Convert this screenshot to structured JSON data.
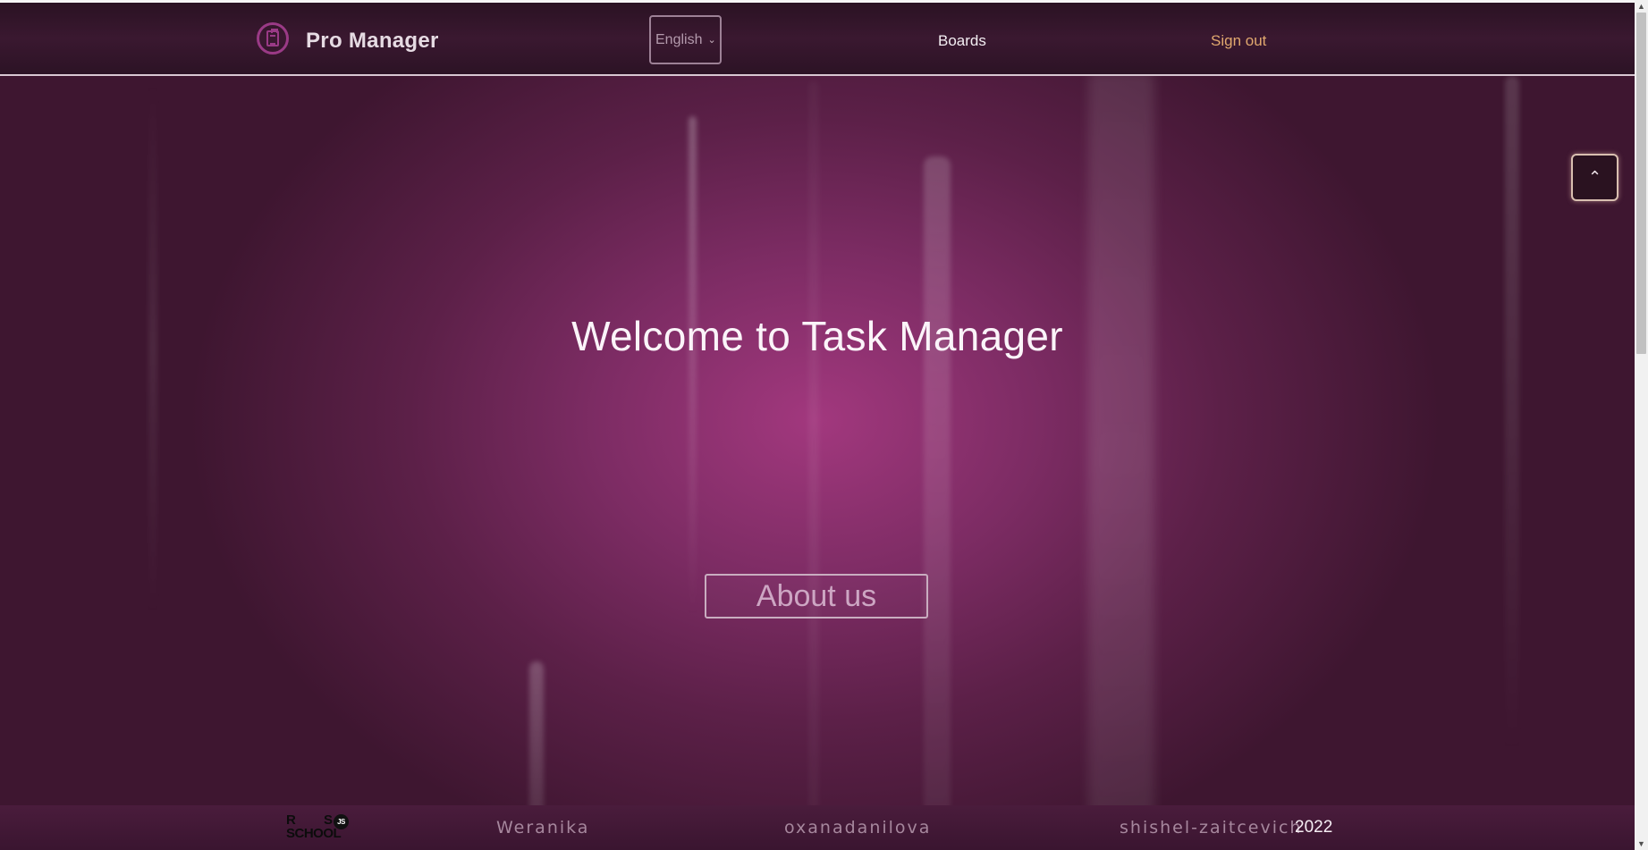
{
  "header": {
    "brand": "Pro Manager",
    "logo_icon": "clipboard-icon",
    "language": {
      "selected": "English",
      "options": [
        "English"
      ]
    },
    "nav": {
      "boards": "Boards",
      "sign_out": "Sign out"
    }
  },
  "hero": {
    "title": "Welcome to Task Manager",
    "about_button": "About us"
  },
  "scroll_top_icon": "chevron-up-icon",
  "footer": {
    "logo_text_line1a": "R",
    "logo_text_line1b": "S",
    "logo_text_line2": "SCHOOL",
    "logo_badge": "JS",
    "authors": [
      "Weranika",
      "oxanadanilova",
      "shishel-zaitcevich"
    ],
    "year": "2022"
  },
  "colors": {
    "accent_signout": "#e0a86e",
    "brand_purple": "#9a3a86",
    "background_center": "#a2387e"
  }
}
